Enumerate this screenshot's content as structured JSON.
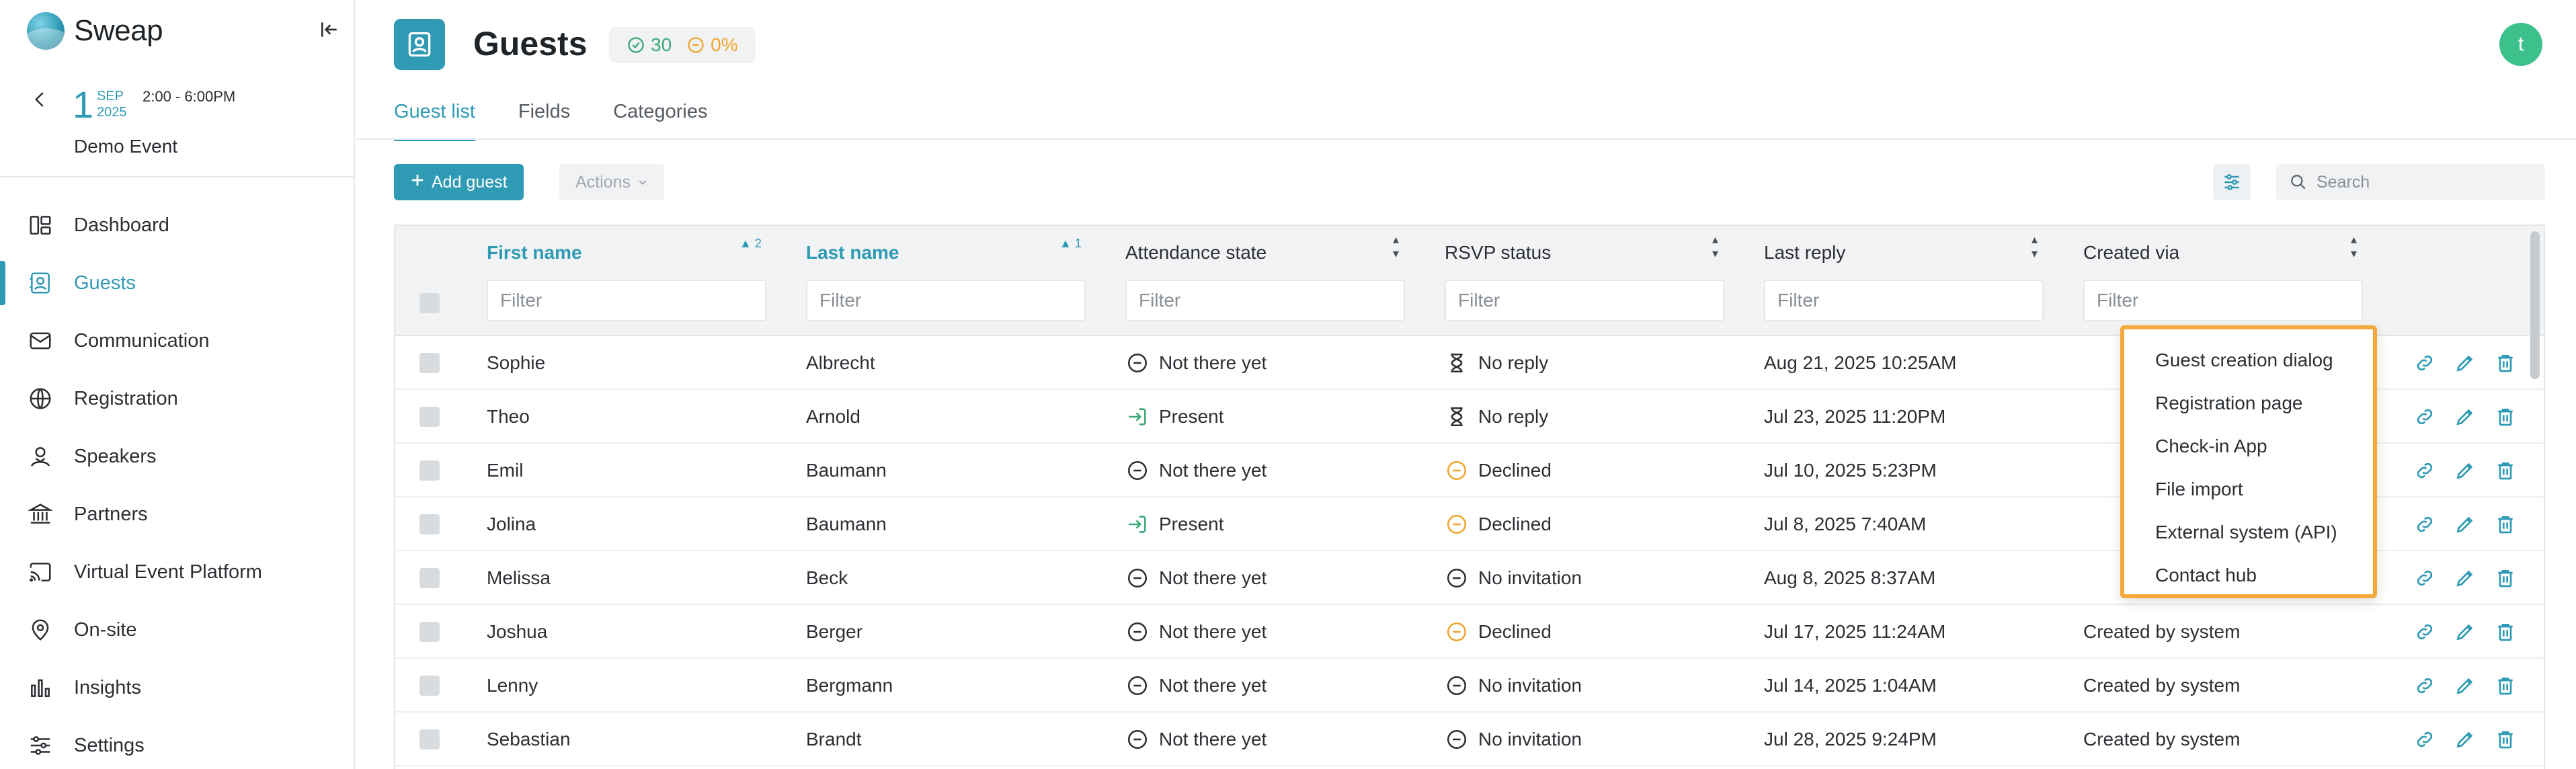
{
  "app": {
    "name": "Sweap"
  },
  "event": {
    "day": "1",
    "month": "SEP",
    "year": "2025",
    "time": "2:00 - 6:00PM",
    "name": "Demo Event"
  },
  "nav": [
    {
      "label": "Dashboard",
      "icon": "dashboard-icon",
      "active": false
    },
    {
      "label": "Guests",
      "icon": "guests-icon",
      "active": true
    },
    {
      "label": "Communication",
      "icon": "mail-icon",
      "active": false
    },
    {
      "label": "Registration",
      "icon": "globe-icon",
      "active": false
    },
    {
      "label": "Speakers",
      "icon": "speaker-icon",
      "active": false
    },
    {
      "label": "Partners",
      "icon": "bank-icon",
      "active": false
    },
    {
      "label": "Virtual Event Platform",
      "icon": "cast-icon",
      "active": false
    },
    {
      "label": "On-site",
      "icon": "location-pin-icon",
      "active": false
    },
    {
      "label": "Insights",
      "icon": "bar-chart-icon",
      "active": false
    },
    {
      "label": "Settings",
      "icon": "sliders-icon",
      "active": false
    }
  ],
  "header": {
    "title": "Guests",
    "stat_present": "30",
    "stat_percent": "0%",
    "avatar_initial": "t"
  },
  "tabs": [
    "Guest list",
    "Fields",
    "Categories"
  ],
  "toolbar": {
    "add_label": "Add guest",
    "actions_label": "Actions",
    "search_placeholder": "Search"
  },
  "table": {
    "columns": [
      {
        "label": "First name",
        "sort": "2",
        "sorted": true
      },
      {
        "label": "Last name",
        "sort": "1",
        "sorted": true
      },
      {
        "label": "Attendance state",
        "sort": "",
        "sorted": false
      },
      {
        "label": "RSVP status",
        "sort": "",
        "sorted": false
      },
      {
        "label": "Last reply",
        "sort": "",
        "sorted": false
      },
      {
        "label": "Created via",
        "sort": "",
        "sorted": false
      }
    ],
    "filter_placeholder": "Filter",
    "rows": [
      {
        "first": "Sophie",
        "last": "Albrecht",
        "attendance": "Not there yet",
        "attendance_icon": "minus-circle",
        "rsvp": "No reply",
        "rsvp_icon": "hourglass",
        "reply": "Aug 21, 2025 10:25AM",
        "created": ""
      },
      {
        "first": "Theo",
        "last": "Arnold",
        "attendance": "Present",
        "attendance_icon": "login",
        "rsvp": "No reply",
        "rsvp_icon": "hourglass",
        "reply": "Jul 23, 2025 11:20PM",
        "created": ""
      },
      {
        "first": "Emil",
        "last": "Baumann",
        "attendance": "Not there yet",
        "attendance_icon": "minus-circle",
        "rsvp": "Declined",
        "rsvp_icon": "declined",
        "reply": "Jul 10, 2025 5:23PM",
        "created": ""
      },
      {
        "first": "Jolina",
        "last": "Baumann",
        "attendance": "Present",
        "attendance_icon": "login",
        "rsvp": "Declined",
        "rsvp_icon": "declined",
        "reply": "Jul 8, 2025 7:40AM",
        "created": ""
      },
      {
        "first": "Melissa",
        "last": "Beck",
        "attendance": "Not there yet",
        "attendance_icon": "minus-circle",
        "rsvp": "No invitation",
        "rsvp_icon": "minus-circle",
        "reply": "Aug 8, 2025 8:37AM",
        "created": ""
      },
      {
        "first": "Joshua",
        "last": "Berger",
        "attendance": "Not there yet",
        "attendance_icon": "minus-circle",
        "rsvp": "Declined",
        "rsvp_icon": "declined",
        "reply": "Jul 17, 2025 11:24AM",
        "created": "Created by system"
      },
      {
        "first": "Lenny",
        "last": "Bergmann",
        "attendance": "Not there yet",
        "attendance_icon": "minus-circle",
        "rsvp": "No invitation",
        "rsvp_icon": "minus-circle",
        "reply": "Jul 14, 2025 1:04AM",
        "created": "Created by system"
      },
      {
        "first": "Sebastian",
        "last": "Brandt",
        "attendance": "Not there yet",
        "attendance_icon": "minus-circle",
        "rsvp": "No invitation",
        "rsvp_icon": "minus-circle",
        "reply": "Jul 28, 2025 9:24PM",
        "created": "Created by system"
      }
    ]
  },
  "dropdown": {
    "items": [
      "Guest creation dialog",
      "Registration page",
      "Check-in App",
      "File import",
      "External system (API)",
      "Contact hub"
    ]
  },
  "colors": {
    "accent": "#2e9ab4",
    "present": "#3aa876",
    "declined": "#f0a42c",
    "highlight_border": "#f4a93a",
    "avatar": "#3cc18d"
  }
}
